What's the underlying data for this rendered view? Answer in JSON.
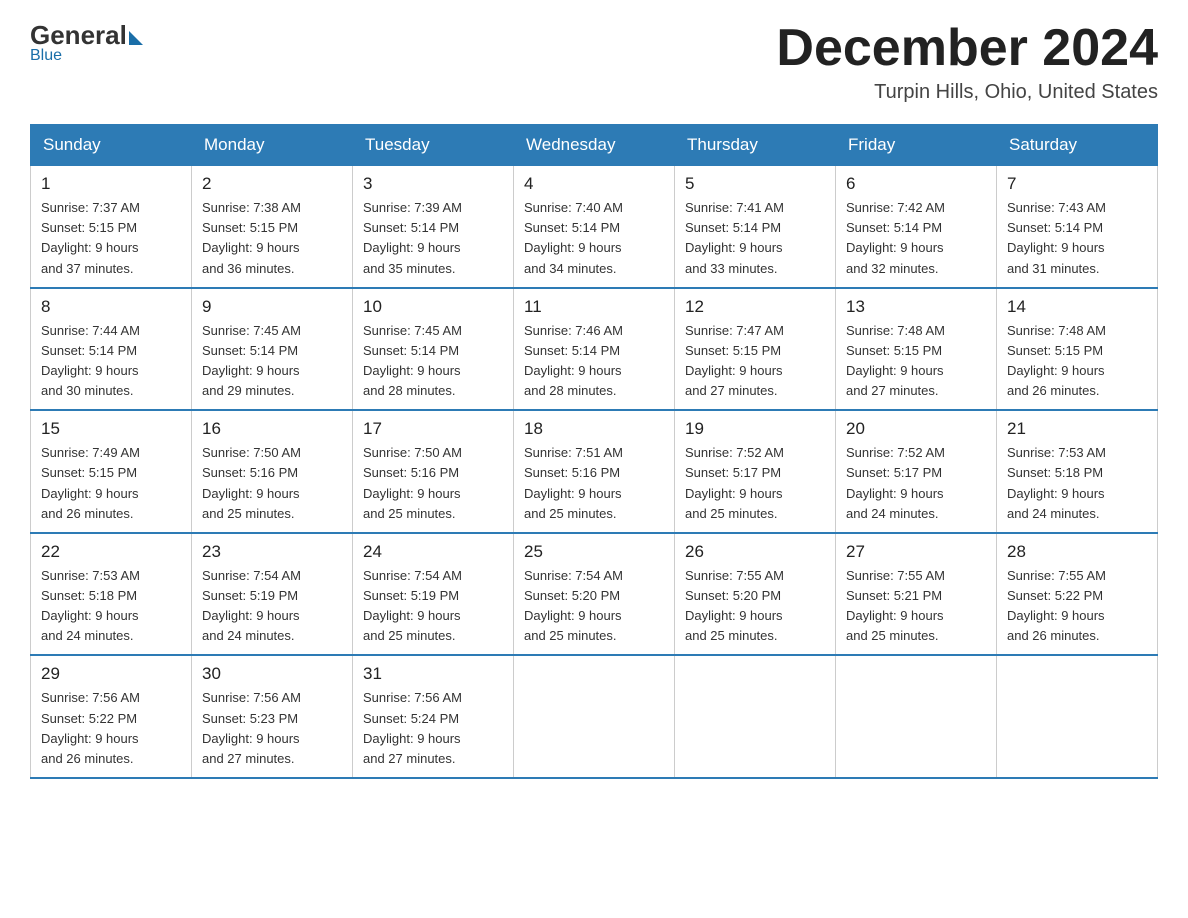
{
  "logo": {
    "general": "General",
    "blue": "Blue",
    "tagline": "Blue"
  },
  "header": {
    "month_title": "December 2024",
    "location": "Turpin Hills, Ohio, United States"
  },
  "days_of_week": [
    "Sunday",
    "Monday",
    "Tuesday",
    "Wednesday",
    "Thursday",
    "Friday",
    "Saturday"
  ],
  "weeks": [
    [
      {
        "day": "1",
        "sunrise": "7:37 AM",
        "sunset": "5:15 PM",
        "daylight": "9 hours and 37 minutes."
      },
      {
        "day": "2",
        "sunrise": "7:38 AM",
        "sunset": "5:15 PM",
        "daylight": "9 hours and 36 minutes."
      },
      {
        "day": "3",
        "sunrise": "7:39 AM",
        "sunset": "5:14 PM",
        "daylight": "9 hours and 35 minutes."
      },
      {
        "day": "4",
        "sunrise": "7:40 AM",
        "sunset": "5:14 PM",
        "daylight": "9 hours and 34 minutes."
      },
      {
        "day": "5",
        "sunrise": "7:41 AM",
        "sunset": "5:14 PM",
        "daylight": "9 hours and 33 minutes."
      },
      {
        "day": "6",
        "sunrise": "7:42 AM",
        "sunset": "5:14 PM",
        "daylight": "9 hours and 32 minutes."
      },
      {
        "day": "7",
        "sunrise": "7:43 AM",
        "sunset": "5:14 PM",
        "daylight": "9 hours and 31 minutes."
      }
    ],
    [
      {
        "day": "8",
        "sunrise": "7:44 AM",
        "sunset": "5:14 PM",
        "daylight": "9 hours and 30 minutes."
      },
      {
        "day": "9",
        "sunrise": "7:45 AM",
        "sunset": "5:14 PM",
        "daylight": "9 hours and 29 minutes."
      },
      {
        "day": "10",
        "sunrise": "7:45 AM",
        "sunset": "5:14 PM",
        "daylight": "9 hours and 28 minutes."
      },
      {
        "day": "11",
        "sunrise": "7:46 AM",
        "sunset": "5:14 PM",
        "daylight": "9 hours and 28 minutes."
      },
      {
        "day": "12",
        "sunrise": "7:47 AM",
        "sunset": "5:15 PM",
        "daylight": "9 hours and 27 minutes."
      },
      {
        "day": "13",
        "sunrise": "7:48 AM",
        "sunset": "5:15 PM",
        "daylight": "9 hours and 27 minutes."
      },
      {
        "day": "14",
        "sunrise": "7:48 AM",
        "sunset": "5:15 PM",
        "daylight": "9 hours and 26 minutes."
      }
    ],
    [
      {
        "day": "15",
        "sunrise": "7:49 AM",
        "sunset": "5:15 PM",
        "daylight": "9 hours and 26 minutes."
      },
      {
        "day": "16",
        "sunrise": "7:50 AM",
        "sunset": "5:16 PM",
        "daylight": "9 hours and 25 minutes."
      },
      {
        "day": "17",
        "sunrise": "7:50 AM",
        "sunset": "5:16 PM",
        "daylight": "9 hours and 25 minutes."
      },
      {
        "day": "18",
        "sunrise": "7:51 AM",
        "sunset": "5:16 PM",
        "daylight": "9 hours and 25 minutes."
      },
      {
        "day": "19",
        "sunrise": "7:52 AM",
        "sunset": "5:17 PM",
        "daylight": "9 hours and 25 minutes."
      },
      {
        "day": "20",
        "sunrise": "7:52 AM",
        "sunset": "5:17 PM",
        "daylight": "9 hours and 24 minutes."
      },
      {
        "day": "21",
        "sunrise": "7:53 AM",
        "sunset": "5:18 PM",
        "daylight": "9 hours and 24 minutes."
      }
    ],
    [
      {
        "day": "22",
        "sunrise": "7:53 AM",
        "sunset": "5:18 PM",
        "daylight": "9 hours and 24 minutes."
      },
      {
        "day": "23",
        "sunrise": "7:54 AM",
        "sunset": "5:19 PM",
        "daylight": "9 hours and 24 minutes."
      },
      {
        "day": "24",
        "sunrise": "7:54 AM",
        "sunset": "5:19 PM",
        "daylight": "9 hours and 25 minutes."
      },
      {
        "day": "25",
        "sunrise": "7:54 AM",
        "sunset": "5:20 PM",
        "daylight": "9 hours and 25 minutes."
      },
      {
        "day": "26",
        "sunrise": "7:55 AM",
        "sunset": "5:20 PM",
        "daylight": "9 hours and 25 minutes."
      },
      {
        "day": "27",
        "sunrise": "7:55 AM",
        "sunset": "5:21 PM",
        "daylight": "9 hours and 25 minutes."
      },
      {
        "day": "28",
        "sunrise": "7:55 AM",
        "sunset": "5:22 PM",
        "daylight": "9 hours and 26 minutes."
      }
    ],
    [
      {
        "day": "29",
        "sunrise": "7:56 AM",
        "sunset": "5:22 PM",
        "daylight": "9 hours and 26 minutes."
      },
      {
        "day": "30",
        "sunrise": "7:56 AM",
        "sunset": "5:23 PM",
        "daylight": "9 hours and 27 minutes."
      },
      {
        "day": "31",
        "sunrise": "7:56 AM",
        "sunset": "5:24 PM",
        "daylight": "9 hours and 27 minutes."
      },
      null,
      null,
      null,
      null
    ]
  ]
}
